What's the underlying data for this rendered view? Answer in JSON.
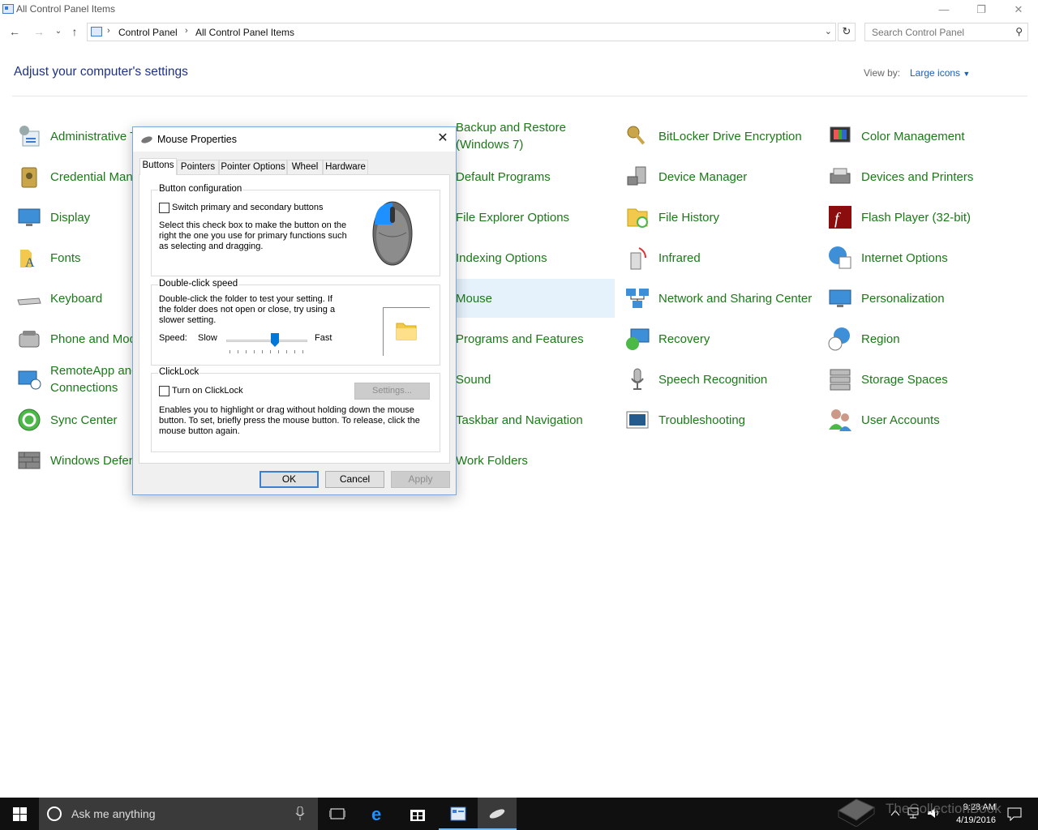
{
  "window": {
    "title": "All Control Panel Items",
    "minimize_glyph": "—",
    "restore_glyph": "❐",
    "close_glyph": "✕"
  },
  "address_bar": {
    "breadcrumbs": [
      "Control Panel",
      "All Control Panel Items"
    ],
    "search_placeholder": "Search Control Panel"
  },
  "header": {
    "title": "Adjust your computer's settings",
    "view_by_label": "View by:",
    "view_by_value": "Large icons"
  },
  "items": [
    [
      "Administrative Tools",
      "Backup and Restore (Windows 7)",
      "BitLocker Drive Encryption",
      "Color Management"
    ],
    [
      "Credential Manager",
      "Default Programs",
      "Device Manager",
      "Devices and Printers"
    ],
    [
      "Display",
      "File Explorer Options",
      "File History",
      "Flash Player (32-bit)"
    ],
    [
      "Fonts",
      "Indexing Options",
      "Infrared",
      "Internet Options"
    ],
    [
      "Keyboard",
      "Mouse",
      "Network and Sharing Center",
      "Personalization"
    ],
    [
      "Phone and Modem",
      "Programs and Features",
      "Recovery",
      "Region"
    ],
    [
      "RemoteApp and Desktop Connections",
      "Sound",
      "Speech Recognition",
      "Storage Spaces"
    ],
    [
      "Sync Center",
      "Taskbar and Navigation",
      "Troubleshooting",
      "User Accounts"
    ],
    [
      "Windows Defender",
      "Work Folders"
    ]
  ],
  "selected_item": "Mouse",
  "dialog": {
    "title": "Mouse Properties",
    "tabs": [
      "Buttons",
      "Pointers",
      "Pointer Options",
      "Wheel",
      "Hardware"
    ],
    "active_tab": "Buttons",
    "button_config": {
      "legend": "Button configuration",
      "checkbox_label": "Switch primary and secondary buttons",
      "checked": false,
      "description": "Select this check box to make the button on the right the one you use for primary functions such as selecting and dragging."
    },
    "double_click": {
      "legend": "Double-click speed",
      "description": "Double-click the folder to test your setting. If the folder does not open or close, try using a slower setting.",
      "speed_label": "Speed:",
      "slow_label": "Slow",
      "fast_label": "Fast",
      "slider_value": 0.6
    },
    "clicklock": {
      "legend": "ClickLock",
      "checkbox_label": "Turn on ClickLock",
      "checked": false,
      "settings_button": "Settings...",
      "description": "Enables you to highlight or drag without holding down the mouse button. To set, briefly press the mouse button. To release, click the mouse button again."
    },
    "buttons": {
      "ok": "OK",
      "cancel": "Cancel",
      "apply": "Apply"
    }
  },
  "taskbar": {
    "search_text": "Ask me anything",
    "time": "9:28 AM",
    "date": "4/19/2016"
  },
  "watermark": "TheCollectionBook",
  "colors": {
    "item_text": "#1b7a17",
    "heading": "#1e3287",
    "link": "#1a5fb4",
    "selection": "#e5f1fb",
    "taskbar": "#101010"
  }
}
